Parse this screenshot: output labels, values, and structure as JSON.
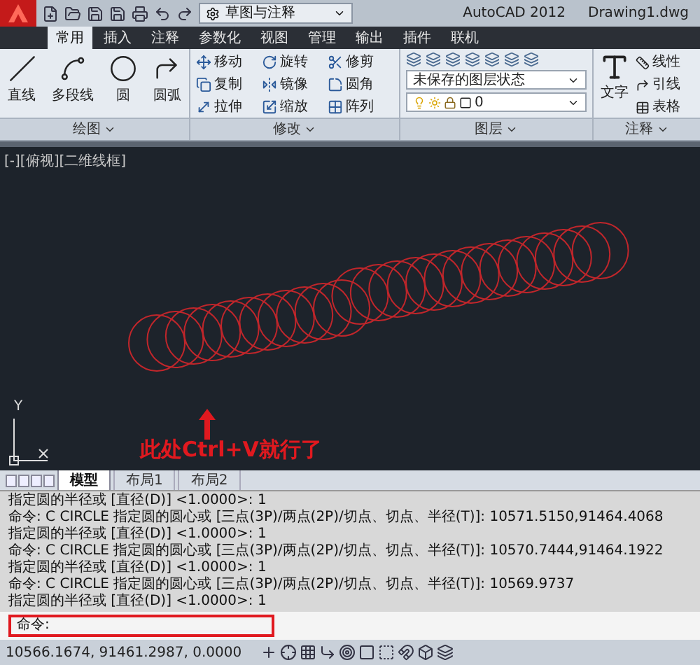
{
  "title_bar": {
    "workspace": "草图与注释",
    "app_name": "AutoCAD 2012",
    "file_name": "Drawing1.dwg"
  },
  "tabs": [
    {
      "label": "常用",
      "selected": true
    },
    {
      "label": "插入",
      "selected": false
    },
    {
      "label": "注释",
      "selected": false
    },
    {
      "label": "参数化",
      "selected": false
    },
    {
      "label": "视图",
      "selected": false
    },
    {
      "label": "管理",
      "selected": false
    },
    {
      "label": "输出",
      "selected": false
    },
    {
      "label": "插件",
      "selected": false
    },
    {
      "label": "联机",
      "selected": false
    }
  ],
  "draw_panel": {
    "title": "绘图",
    "tools": [
      "直线",
      "多段线",
      "圆",
      "圆弧"
    ]
  },
  "modify_panel": {
    "title": "修改",
    "tools": [
      "移动",
      "旋转",
      "修剪",
      "复制",
      "镜像",
      "圆角",
      "拉伸",
      "缩放",
      "阵列"
    ]
  },
  "layers_panel": {
    "title": "图层",
    "layer_state": "未保存的图层状态",
    "current_layer": "0"
  },
  "annotation_panel": {
    "title": "注释",
    "text_tool": "文字",
    "tools": [
      "线性",
      "引线",
      "表格"
    ]
  },
  "viewport": {
    "label": "[-][俯视][二维线框]",
    "ucs_y": "Y",
    "annotation": "此处Ctrl+V就行了"
  },
  "layout_tabs": [
    {
      "label": "模型",
      "selected": true
    },
    {
      "label": "布局1",
      "selected": false
    },
    {
      "label": "布局2",
      "selected": false
    }
  ],
  "command_history": [
    "指定圆的半径或 [直径(D)] <1.0000>: 1",
    "命令: C CIRCLE 指定圆的圆心或 [三点(3P)/两点(2P)/切点、切点、半径(T)]: 10571.5150,91464.4068",
    "指定圆的半径或 [直径(D)] <1.0000>: 1",
    "命令: C CIRCLE 指定圆的圆心或 [三点(3P)/两点(2P)/切点、切点、半径(T)]: 10570.7444,91464.1922",
    "指定圆的半径或 [直径(D)] <1.0000>: 1",
    "命令: C CIRCLE 指定圆的圆心或 [三点(3P)/两点(2P)/切点、切点、半径(T)]: 10569.9737",
    "指定圆的半径或 [直径(D)] <1.0000>: 1"
  ],
  "command_prompt": "命令:",
  "status_bar": {
    "coordinates": "10566.1674, 91461.2987, 0.0000"
  }
}
